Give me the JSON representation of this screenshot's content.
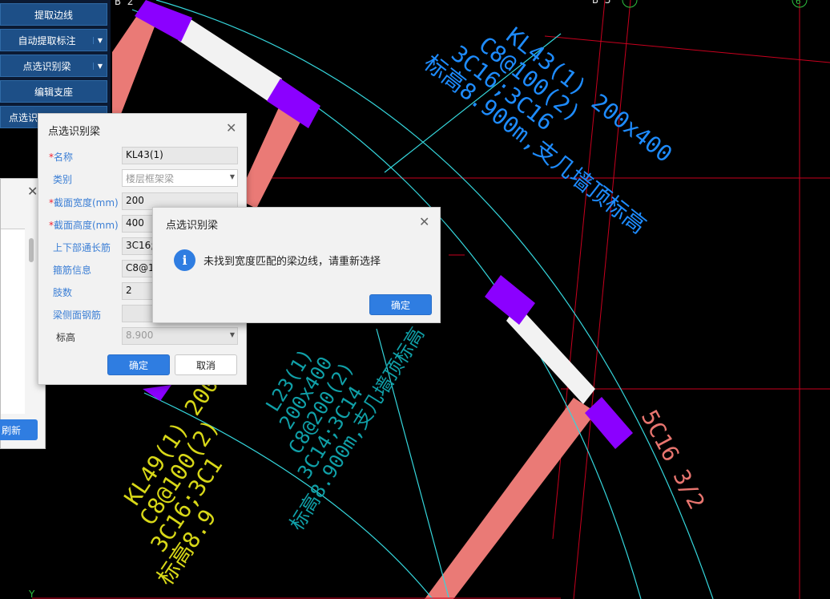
{
  "toolbar": {
    "extract_edge": "提取边线",
    "auto_extract_annotation": "自动提取标注",
    "pick_identify_beam": "点选识别梁",
    "edit_support": "编辑支座",
    "pick_identify_partial": "点选识"
  },
  "cad": {
    "grid_labels": [
      "B 2",
      "B 3",
      "6"
    ],
    "axis_y": "Y",
    "annotations": {
      "kl43": [
        "KL43(1) 200x400",
        "C8@100(2)",
        "3C16;3C16",
        "标高8.900m,支几墙顶标高"
      ],
      "l23": [
        "L23(1)",
        "200x400",
        "C8@200(2)",
        "3C14;3C14",
        "标高8.900m,支几墙顶标高"
      ],
      "kl49": [
        "KL49(1) 200",
        "C8@100(2)",
        "3C16;3C1",
        "标高8.9"
      ],
      "rebar": "5C16 3/2"
    },
    "colors": {
      "beam_fill": "#ea7a76",
      "support": "#8b00ff",
      "arc": "#35d6dc",
      "grid": "#c8001e",
      "annotation_blue": "#1e8cff",
      "annotation_teal": "#10a0a8",
      "annotation_yellow": "#d8d818",
      "rebar_label": "#e8756f"
    }
  },
  "bg_panel": {
    "close": "✕",
    "refresh_label": "刷新"
  },
  "dialog": {
    "title": "点选识别梁",
    "close": "✕",
    "fields": {
      "name": {
        "label": "名称",
        "value": "KL43(1)"
      },
      "category": {
        "label": "类别",
        "value": "楼层框架梁"
      },
      "width": {
        "label": "截面宽度(mm)",
        "value": "200"
      },
      "height": {
        "label": "截面高度(mm)",
        "value": "400"
      },
      "through_rebar": {
        "label": "上下部通长筋",
        "value": "3C16;3C16"
      },
      "stirrup": {
        "label": "箍筋信息",
        "value": "C8@100(2)"
      },
      "legs": {
        "label": "肢数",
        "value": "2"
      },
      "side_rebar": {
        "label": "梁侧面钢筋",
        "value": ""
      },
      "elevation": {
        "label": "标高",
        "value": "8.900"
      }
    },
    "required_mark": "*",
    "ok": "确定",
    "cancel": "取消"
  },
  "message": {
    "title": "点选识别梁",
    "close": "✕",
    "icon": "info-icon",
    "text": "未找到宽度匹配的梁边线，请重新选择",
    "ok": "确定"
  }
}
